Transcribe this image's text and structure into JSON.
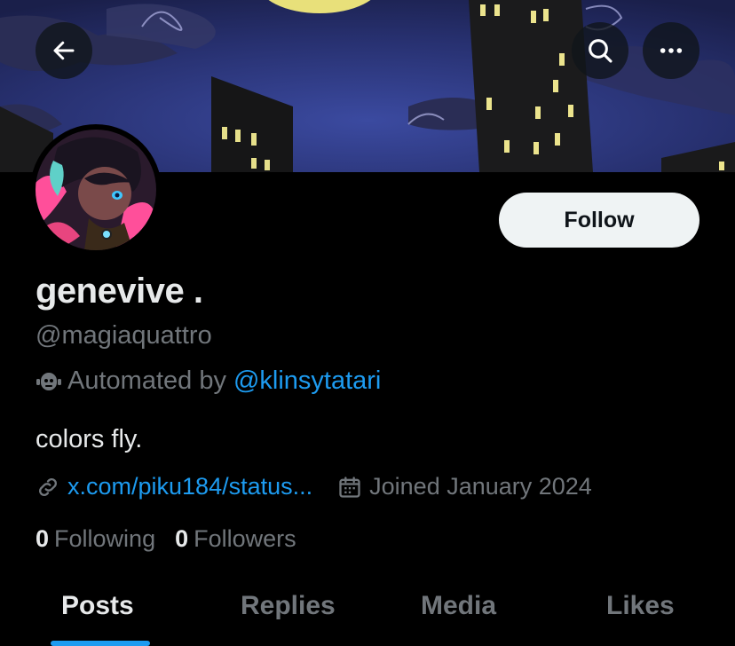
{
  "header": {
    "back_icon": "arrow-left-icon",
    "search_icon": "search-icon",
    "more_icon": "more-horizontal-icon"
  },
  "profile": {
    "display_name": "genevive .",
    "handle": "@magiaquattro",
    "automated_prefix": "Automated by",
    "automated_link": "@klinsytatari",
    "bio": "colors fly.",
    "url": "x.com/piku184/status...",
    "joined": "Joined January 2024",
    "following_count": "0",
    "following_label": "Following",
    "followers_count": "0",
    "followers_label": "Followers"
  },
  "actions": {
    "follow_label": "Follow"
  },
  "tabs": [
    {
      "label": "Posts",
      "active": true
    },
    {
      "label": "Replies",
      "active": false
    },
    {
      "label": "Media",
      "active": false
    },
    {
      "label": "Likes",
      "active": false
    }
  ],
  "colors": {
    "accent": "#1d9bf0",
    "background": "#000000",
    "text_primary": "#e7e9ea",
    "text_secondary": "#71767b",
    "follow_button_bg": "#eff3f4"
  }
}
